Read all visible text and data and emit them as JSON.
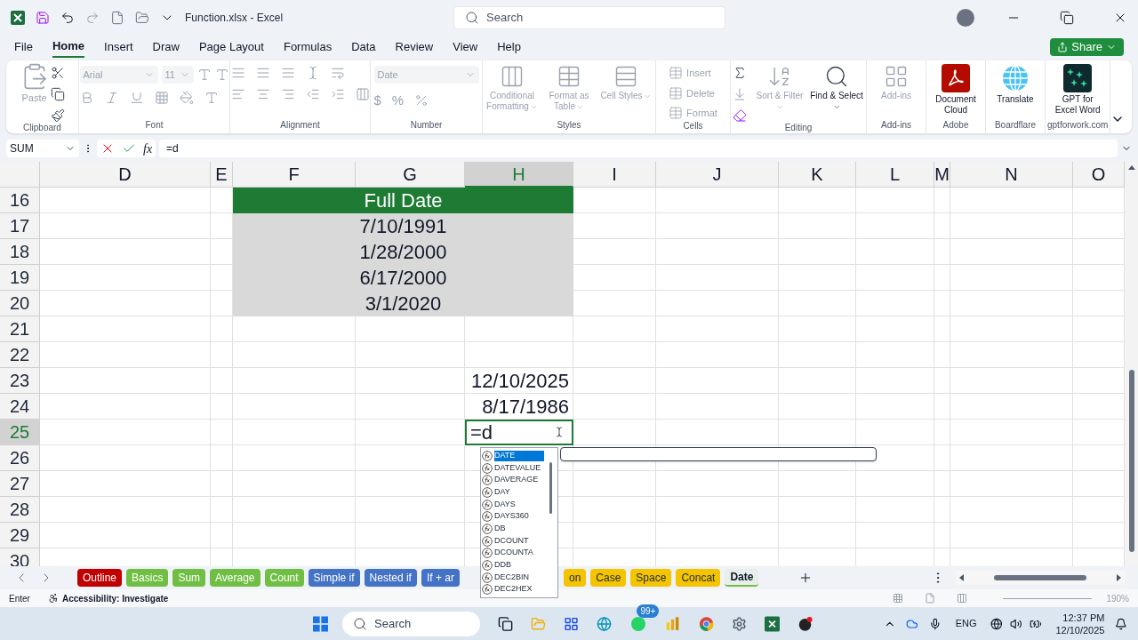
{
  "title_bar": {
    "file": "Function.xlsx",
    "separator": "-",
    "app": "Excel",
    "search": {
      "placeholder": "Search"
    }
  },
  "ribbon_tabs": [
    {
      "label": "File",
      "selected": false
    },
    {
      "label": "Home",
      "selected": true
    },
    {
      "label": "Insert",
      "selected": false
    },
    {
      "label": "Draw",
      "selected": false
    },
    {
      "label": "Page Layout",
      "selected": false
    },
    {
      "label": "Formulas",
      "selected": false
    },
    {
      "label": "Data",
      "selected": false
    },
    {
      "label": "Review",
      "selected": false
    },
    {
      "label": "View",
      "selected": false
    },
    {
      "label": "Help",
      "selected": false
    }
  ],
  "share": "Share",
  "ribbon": [
    {
      "kind": "clipboard",
      "name": "Clipboard",
      "paste": "Paste"
    },
    {
      "kind": "font",
      "name": "Font",
      "font": "Arial",
      "size": "11"
    },
    {
      "kind": "alignment",
      "name": "Alignment"
    },
    {
      "kind": "number",
      "name": "Number",
      "format": "Date",
      "currency": "$",
      "percent": "%"
    },
    {
      "kind": "large",
      "name": "Styles",
      "buttons": [
        {
          "label": "Conditional Formatting",
          "kind": "conditional",
          "disabled": true,
          "menu": true
        },
        {
          "label": "Format as Table",
          "kind": "table",
          "disabled": true,
          "menu": true
        },
        {
          "label": "Cell Styles",
          "kind": "styles",
          "disabled": true,
          "menu": true
        }
      ]
    },
    {
      "kind": "cells",
      "name": "Cells",
      "buttons": [
        {
          "label": "Insert",
          "disabled": true
        },
        {
          "label": "Delete",
          "disabled": true
        },
        {
          "label": "Format",
          "disabled": true
        }
      ]
    },
    {
      "kind": "editing",
      "name": "Editing",
      "buttons": [
        {
          "label": "Sort & Filter",
          "kind": "sort",
          "disabled": true,
          "menu": true
        },
        {
          "label": "Find & Select",
          "kind": "find",
          "disabled": false,
          "menu": true
        }
      ]
    },
    {
      "kind": "large",
      "name": "Add-ins",
      "buttons": [
        {
          "label": "Add-ins",
          "kind": "addins",
          "disabled": true,
          "menu": false
        }
      ]
    },
    {
      "kind": "large",
      "name": "Adobe",
      "buttons": [
        {
          "label": "Document Cloud",
          "kind": "pdf",
          "disabled": false,
          "menu": false
        }
      ]
    },
    {
      "kind": "large",
      "name": "Boardflare",
      "buttons": [
        {
          "label": "Translate",
          "kind": "globe",
          "disabled": false,
          "menu": false
        }
      ]
    },
    {
      "kind": "large",
      "name": "gptforwork.com",
      "buttons": [
        {
          "label": "GPT for Excel Word",
          "kind": "gpt",
          "disabled": false,
          "menu": false
        }
      ]
    }
  ],
  "formula_bar": {
    "name_box": "SUM",
    "function_label": "fx",
    "formula": "=d"
  },
  "columns": [
    {
      "label": "D",
      "selected": false
    },
    {
      "label": "E",
      "selected": false
    },
    {
      "label": "F",
      "selected": false
    },
    {
      "label": "G",
      "selected": false
    },
    {
      "label": "H",
      "selected": true
    },
    {
      "label": "I",
      "selected": false
    },
    {
      "label": "J",
      "selected": false
    },
    {
      "label": "K",
      "selected": false
    },
    {
      "label": "L",
      "selected": false
    },
    {
      "label": "M",
      "selected": false
    },
    {
      "label": "N",
      "selected": false
    },
    {
      "label": "O",
      "selected": false
    }
  ],
  "rows": [
    {
      "number": "16",
      "kind": "header",
      "text": "Full Date",
      "selected": false
    },
    {
      "number": "17",
      "kind": "date",
      "text": "7/10/1991",
      "selected": false
    },
    {
      "number": "18",
      "kind": "date",
      "text": "1/28/2000",
      "selected": false
    },
    {
      "number": "19",
      "kind": "date",
      "text": "6/17/2000",
      "selected": false
    },
    {
      "number": "20",
      "kind": "date",
      "text": "3/1/2020",
      "selected": false
    },
    {
      "number": "21",
      "kind": "empty",
      "selected": false
    },
    {
      "number": "22",
      "kind": "empty",
      "selected": false
    },
    {
      "number": "23",
      "kind": "value",
      "text": "12/10/2025",
      "selected": false
    },
    {
      "number": "24",
      "kind": "value",
      "text": "8/17/1986",
      "selected": false
    },
    {
      "number": "25",
      "kind": "editing",
      "text": "=d",
      "selected": true
    },
    {
      "number": "26",
      "kind": "empty",
      "selected": false
    },
    {
      "number": "27",
      "kind": "empty",
      "selected": false
    },
    {
      "number": "28",
      "kind": "empty",
      "selected": false
    },
    {
      "number": "29",
      "kind": "empty",
      "selected": false
    },
    {
      "number": "30",
      "kind": "empty",
      "selected": false
    }
  ],
  "autocomplete": [
    {
      "label": "DATE",
      "selected": true
    },
    {
      "label": "DATEVALUE",
      "selected": false
    },
    {
      "label": "DAVERAGE",
      "selected": false
    },
    {
      "label": "DAY",
      "selected": false
    },
    {
      "label": "DAYS",
      "selected": false
    },
    {
      "label": "DAYS360",
      "selected": false
    },
    {
      "label": "DB",
      "selected": false
    },
    {
      "label": "DCOUNT",
      "selected": false
    },
    {
      "label": "DCOUNTA",
      "selected": false
    },
    {
      "label": "DDB",
      "selected": false
    },
    {
      "label": "DEC2BIN",
      "selected": false
    },
    {
      "label": "DEC2HEX",
      "selected": false
    }
  ],
  "sheet_tabs": [
    {
      "label": "Outline",
      "color": "#c00000",
      "selected": false
    },
    {
      "label": "Basics",
      "color": "#70bf44",
      "selected": false
    },
    {
      "label": "Sum",
      "color": "#70bf44",
      "selected": false
    },
    {
      "label": "Average",
      "color": "#70bf44",
      "selected": false
    },
    {
      "label": "Count",
      "color": "#70bf44",
      "selected": false
    },
    {
      "label": "Simple if",
      "color": "#4472c4",
      "selected": false
    },
    {
      "label": "Nested if",
      "color": "#4472c4",
      "selected": false
    },
    {
      "label": "If + ar",
      "color": "#4472c4",
      "selected": false
    },
    {
      "label": "on",
      "color": "#f5c400",
      "selected": false
    },
    {
      "label": "Case",
      "color": "#f5c400",
      "selected": false
    },
    {
      "label": "Space",
      "color": "#f5c400",
      "selected": false
    },
    {
      "label": "Concat",
      "color": "#f5c400",
      "selected": false
    },
    {
      "label": "Date",
      "color": "#70bf44",
      "selected": true
    }
  ],
  "status_bar": {
    "mode": "Enter",
    "accessibility": "Accessibility: Investigate",
    "zoom": "190%"
  },
  "taskbar": {
    "search": {
      "placeholder": "Search"
    },
    "badge": "99+",
    "language": "ENG",
    "time": "12:37 PM",
    "date": "12/10/2025"
  }
}
